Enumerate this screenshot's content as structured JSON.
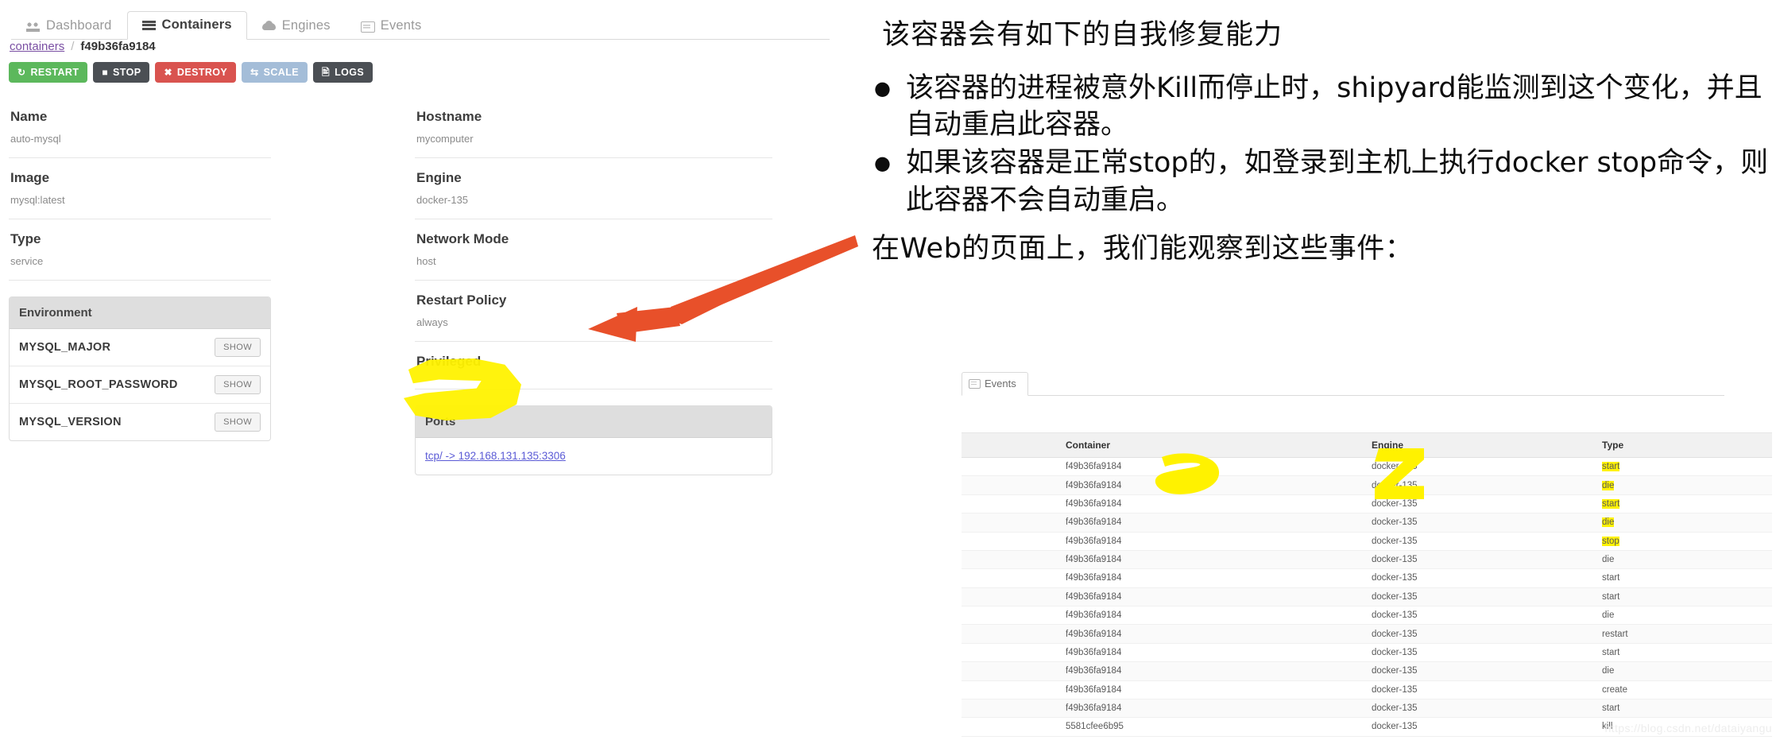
{
  "shipyard": {
    "tabs": [
      {
        "label": "Dashboard",
        "icon": "dashboard-icon",
        "active": false
      },
      {
        "label": "Containers",
        "icon": "containers-icon",
        "active": true
      },
      {
        "label": "Engines",
        "icon": "cloud-icon",
        "active": false
      },
      {
        "label": "Events",
        "icon": "events-icon",
        "active": false
      }
    ],
    "breadcrumb": {
      "root": "containers",
      "separator": "/",
      "current": "f49b36fa9184"
    },
    "actions": [
      {
        "label": "RESTART",
        "icon": "refresh-icon",
        "color": "#5cb85c"
      },
      {
        "label": "STOP",
        "icon": "stop-square-icon",
        "color": "#4b4f54"
      },
      {
        "label": "DESTROY",
        "icon": "times-circle-icon",
        "color": "#d9534f"
      },
      {
        "label": "SCALE",
        "icon": "exchange-icon",
        "color": "#a4bdd8"
      },
      {
        "label": "LOGS",
        "icon": "file-text-icon",
        "color": "#4b4f54"
      }
    ],
    "left_fields": [
      {
        "label": "Name",
        "value": "auto-mysql"
      },
      {
        "label": "Image",
        "value": "mysql:latest"
      },
      {
        "label": "Type",
        "value": "service"
      }
    ],
    "mid_fields": [
      {
        "label": "Hostname",
        "value": "mycomputer"
      },
      {
        "label": "Engine",
        "value": "docker-135"
      },
      {
        "label": "Network Mode",
        "value": "host"
      },
      {
        "label": "Restart Policy",
        "value": "always"
      },
      {
        "label": "Privileged",
        "value": ""
      }
    ],
    "environment": {
      "title": "Environment",
      "show_label": "SHOW",
      "rows": [
        "MYSQL_MAJOR",
        "MYSQL_ROOT_PASSWORD",
        "MYSQL_VERSION"
      ]
    },
    "ports": {
      "title": "Ports",
      "rows": [
        "tcp/ -> 192.168.131.135:3306"
      ]
    }
  },
  "slide": {
    "title": "该容器会有如下的自我修复能力",
    "bullets": [
      "该容器的进程被意外Kill而停止时，shipyard能监测到这个变化，并且自动重启此容器。",
      "如果该容器是正常stop的，如登录到主机上执行docker stop命令，则此容器不会自动重启。"
    ],
    "bullet_marker": "●",
    "footer": "在Web的页面上，我们能观察到这些事件："
  },
  "events_panel": {
    "tab_label": "Events",
    "tab_icon": "events-icon",
    "columns": [
      "Container",
      "Engine",
      "Type"
    ],
    "rows": [
      {
        "container": "f49b36fa9184",
        "engine": "docker-135",
        "type": "start",
        "type_marked": true
      },
      {
        "container": "f49b36fa9184",
        "engine": "docker-135",
        "type": "die",
        "type_marked": true
      },
      {
        "container": "f49b36fa9184",
        "engine": "docker-135",
        "type": "start",
        "type_marked": true
      },
      {
        "container": "f49b36fa9184",
        "engine": "docker-135",
        "type": "die",
        "type_marked": true
      },
      {
        "container": "f49b36fa9184",
        "engine": "docker-135",
        "type": "stop",
        "type_marked": true
      },
      {
        "container": "f49b36fa9184",
        "engine": "docker-135",
        "type": "die",
        "type_marked": false
      },
      {
        "container": "f49b36fa9184",
        "engine": "docker-135",
        "type": "start",
        "type_marked": false
      },
      {
        "container": "f49b36fa9184",
        "engine": "docker-135",
        "type": "start",
        "type_marked": false
      },
      {
        "container": "f49b36fa9184",
        "engine": "docker-135",
        "type": "die",
        "type_marked": false
      },
      {
        "container": "f49b36fa9184",
        "engine": "docker-135",
        "type": "restart",
        "type_marked": false
      },
      {
        "container": "f49b36fa9184",
        "engine": "docker-135",
        "type": "start",
        "type_marked": false
      },
      {
        "container": "f49b36fa9184",
        "engine": "docker-135",
        "type": "die",
        "type_marked": false
      },
      {
        "container": "f49b36fa9184",
        "engine": "docker-135",
        "type": "create",
        "type_marked": false
      },
      {
        "container": "f49b36fa9184",
        "engine": "docker-135",
        "type": "start",
        "type_marked": false
      },
      {
        "container": "5581cfee6b95",
        "engine": "docker-135",
        "type": "kill",
        "type_marked": false
      }
    ]
  },
  "watermark": "https://blog.csdn.net/dataiyangu",
  "colors": {
    "highlight": "#fff200",
    "arrow": "#e8502a",
    "restart_button": "#5cb85c",
    "destroy_button": "#d9534f",
    "link": "#5b5bd6"
  }
}
